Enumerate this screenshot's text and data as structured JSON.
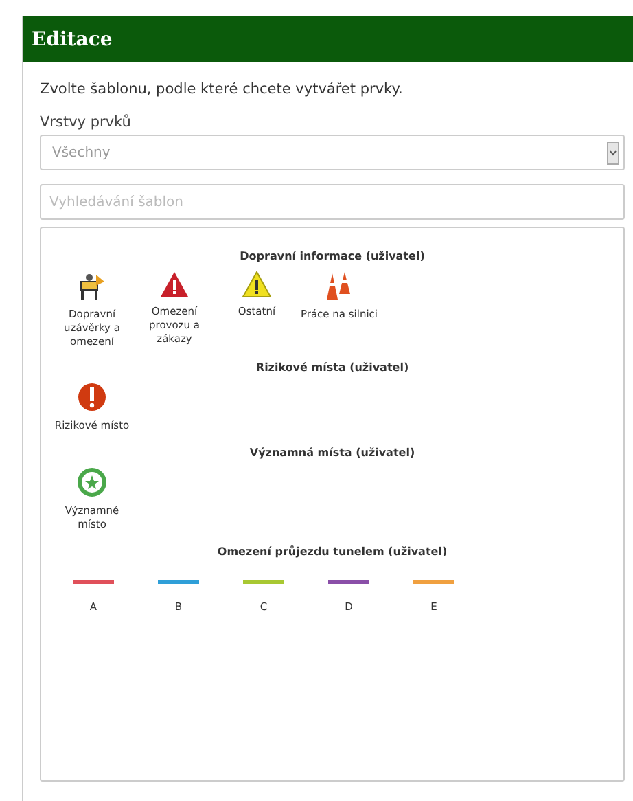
{
  "panel": {
    "title": "Editace"
  },
  "intro": "Zvolte šablonu, podle které chcete vytvářet prvky.",
  "layer_select": {
    "label": "Vrstvy prvků",
    "value": "Všechny"
  },
  "search": {
    "placeholder": "Vyhledávání šablon"
  },
  "sections": [
    {
      "title": "Dopravní informace (uživatel)",
      "items": [
        {
          "kind": "icon",
          "label": "Dopravní uzávěrky a omezení"
        },
        {
          "kind": "icon",
          "label": "Omezení provozu a zákazy"
        },
        {
          "kind": "icon",
          "label": "Ostatní"
        },
        {
          "kind": "icon",
          "label": "Práce na silnici"
        }
      ]
    },
    {
      "title": "Rizikové místa (uživatel)",
      "items": [
        {
          "kind": "icon",
          "label": "Rizikové místo"
        }
      ]
    },
    {
      "title": "Významná místa (uživatel)",
      "items": [
        {
          "kind": "icon",
          "label": "Významné místo"
        }
      ]
    },
    {
      "title": "Omezení průjezdu tunelem (uživatel)",
      "items": [
        {
          "kind": "line",
          "label": "A",
          "color": "#e0505a"
        },
        {
          "kind": "line",
          "label": "B",
          "color": "#2f9fd8"
        },
        {
          "kind": "line",
          "label": "C",
          "color": "#a8c832"
        },
        {
          "kind": "line",
          "label": "D",
          "color": "#8a4fa8"
        },
        {
          "kind": "line",
          "label": "E",
          "color": "#f0a040"
        }
      ]
    }
  ]
}
